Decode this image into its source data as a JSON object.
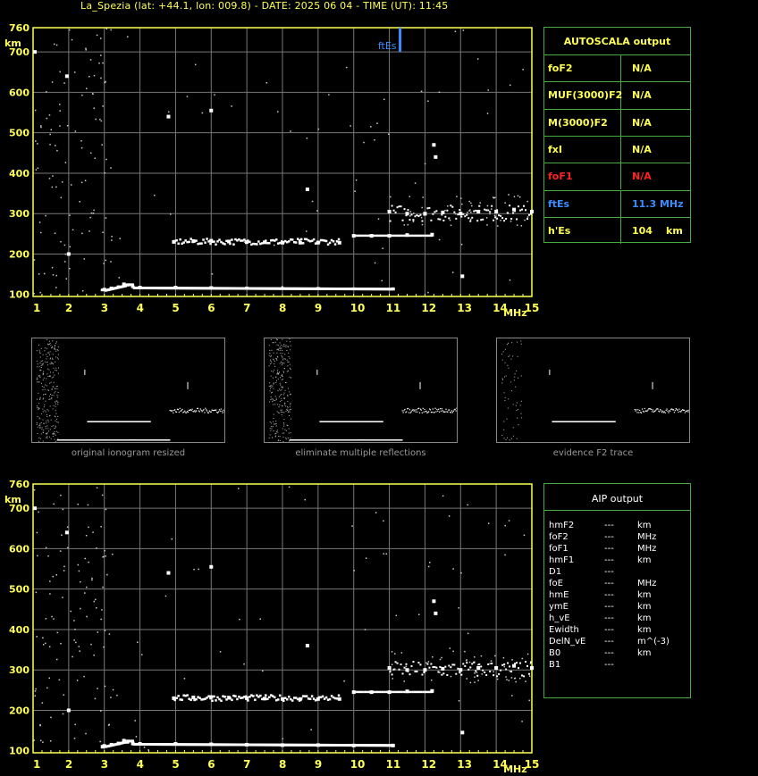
{
  "header": "La_Spezia (lat: +44.1, lon: 009.8) - DATE: 2025 06 04 - TIME (UT): 11:45",
  "colors": {
    "axis": "#ffff55",
    "grid": "#777777",
    "table_border": "#44aa44",
    "red": "#ff2222",
    "blue": "#3a8cff",
    "yellow": "#ffff55"
  },
  "chart_data": [
    {
      "type": "scatter",
      "title": "",
      "xlabel": "MHz",
      "ylabel": "km",
      "xlim": [
        1,
        15
      ],
      "ylim": [
        95,
        760
      ],
      "x_ticks": [
        "1",
        "2",
        "3",
        "4",
        "5",
        "6",
        "7",
        "8",
        "9",
        "10",
        "11",
        "12",
        "13",
        "14",
        "15"
      ],
      "y_ticks": [
        "100",
        "200",
        "300",
        "400",
        "500",
        "600",
        "700",
        "760"
      ],
      "grid": true,
      "annotation": {
        "text": "ftEs",
        "x": 11.3,
        "y_from": 700,
        "y_to": 760
      },
      "series": [
        {
          "trace": "E-layer",
          "points": [
            [
              2.95,
              110
            ],
            [
              3.0,
              112
            ],
            [
              3.2,
              115
            ],
            [
              3.4,
              118
            ],
            [
              3.55,
              125
            ],
            [
              3.65,
              122
            ],
            [
              3.8,
              118
            ],
            [
              4.0,
              117
            ],
            [
              5,
              117
            ],
            [
              6,
              116
            ],
            [
              7,
              115
            ],
            [
              8,
              114
            ],
            [
              9,
              114
            ],
            [
              10,
              113
            ],
            [
              11.1,
              113
            ]
          ]
        },
        {
          "trace": "F-layer",
          "points": [
            [
              4.95,
              230
            ],
            [
              5.5,
              232
            ],
            [
              6,
              233
            ],
            [
              6.5,
              231
            ],
            [
              7,
              230
            ],
            [
              7.5,
              229
            ],
            [
              8,
              228
            ],
            [
              8.5,
              228
            ],
            [
              9,
              228
            ],
            [
              9.6,
              228
            ],
            [
              10.0,
              245
            ],
            [
              10.5,
              245
            ],
            [
              11.0,
              245
            ],
            [
              11.5,
              247
            ],
            [
              12.2,
              248
            ],
            [
              11.0,
              305
            ],
            [
              11.5,
              300
            ],
            [
              12,
              300
            ],
            [
              12.5,
              303
            ],
            [
              13,
              300
            ],
            [
              13.5,
              305
            ],
            [
              14,
              305
            ],
            [
              14.5,
              310
            ],
            [
              15,
              305
            ]
          ]
        },
        {
          "trace": "sporadic",
          "points": [
            [
              4.8,
              540
            ],
            [
              6.0,
              555
            ],
            [
              8.7,
              360
            ],
            [
              12.25,
              470
            ],
            [
              12.3,
              440
            ],
            [
              13.05,
              145
            ],
            [
              2.0,
              200
            ],
            [
              1.95,
              640
            ],
            [
              1.05,
              700
            ]
          ]
        }
      ]
    },
    {
      "type": "scatter",
      "title": "",
      "xlabel": "MHz",
      "ylabel": "km",
      "xlim": [
        1,
        15
      ],
      "ylim": [
        95,
        760
      ],
      "x_ticks": [
        "1",
        "2",
        "3",
        "4",
        "5",
        "6",
        "7",
        "8",
        "9",
        "10",
        "11",
        "12",
        "13",
        "14",
        "15"
      ],
      "y_ticks": [
        "100",
        "200",
        "300",
        "400",
        "500",
        "600",
        "700",
        "760"
      ],
      "grid": true
    }
  ],
  "autoscala": {
    "title": "AUTOSCALA output",
    "rows": [
      {
        "label": "foF2",
        "value": "N/A",
        "unit": "",
        "color": "#ffff55"
      },
      {
        "label": "MUF(3000)F2",
        "value": "N/A",
        "unit": "",
        "color": "#ffff55"
      },
      {
        "label": "M(3000)F2",
        "value": "N/A",
        "unit": "",
        "color": "#ffff55"
      },
      {
        "label": "fxI",
        "value": "N/A",
        "unit": "",
        "color": "#ffff55"
      },
      {
        "label": "foF1",
        "value": "N/A",
        "unit": "",
        "color": "#ff2222"
      },
      {
        "label": "ftEs",
        "value": "11.3 MHz",
        "unit": "",
        "color": "#3a8cff"
      },
      {
        "label": "h'Es",
        "value": "104",
        "unit": "km",
        "color": "#ffff55"
      }
    ]
  },
  "thumbnails": [
    {
      "caption": "original ionogram resized"
    },
    {
      "caption": "eliminate multiple reflections"
    },
    {
      "caption": "evidence F2 trace"
    }
  ],
  "aip": {
    "title": "AIP output",
    "rows": [
      {
        "label": "hmF2",
        "value": "---",
        "unit": "km"
      },
      {
        "label": "foF2",
        "value": "---",
        "unit": "MHz"
      },
      {
        "label": "foF1",
        "value": "---",
        "unit": "MHz"
      },
      {
        "label": "hmF1",
        "value": "---",
        "unit": "km"
      },
      {
        "label": "D1",
        "value": "---",
        "unit": ""
      },
      {
        "label": "foE",
        "value": "---",
        "unit": "MHz"
      },
      {
        "label": "hmE",
        "value": "---",
        "unit": "km"
      },
      {
        "label": "ymE",
        "value": "---",
        "unit": "km"
      },
      {
        "label": "h_vE",
        "value": "---",
        "unit": "km"
      },
      {
        "label": "Ewidth",
        "value": "---",
        "unit": "km"
      },
      {
        "label": "DelN_vE",
        "value": "---",
        "unit": "m^(-3)"
      },
      {
        "label": "B0",
        "value": "---",
        "unit": "km"
      },
      {
        "label": "B1",
        "value": "---",
        "unit": ""
      }
    ]
  }
}
